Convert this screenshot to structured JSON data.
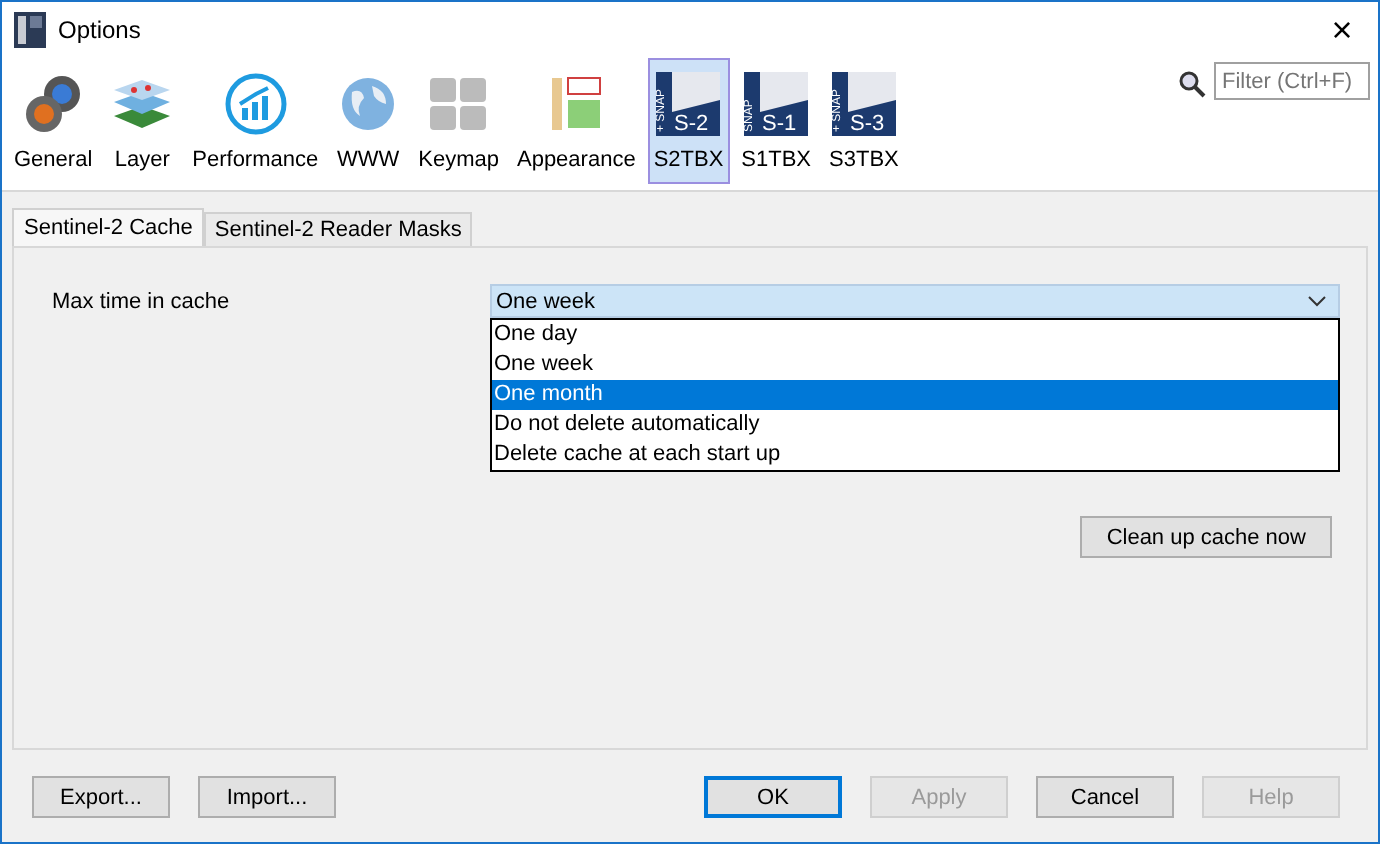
{
  "window": {
    "title": "Options",
    "close": "×"
  },
  "toolbar": {
    "items": [
      {
        "kind": "gears",
        "label": "General",
        "selected": false
      },
      {
        "kind": "layers",
        "label": "Layer",
        "selected": false
      },
      {
        "kind": "performance",
        "label": "Performance",
        "selected": false
      },
      {
        "kind": "globe",
        "label": "WWW",
        "selected": false
      },
      {
        "kind": "keys",
        "label": "Keymap",
        "selected": false
      },
      {
        "kind": "appearance",
        "label": "Appearance",
        "selected": false
      },
      {
        "kind": "snap",
        "label": "S2TBX",
        "selected": true,
        "badge": "S-2",
        "badge_top": "+ SNAP"
      },
      {
        "kind": "snap",
        "label": "S1TBX",
        "selected": false,
        "badge": "S-1",
        "badge_top": "SNAP"
      },
      {
        "kind": "snap",
        "label": "S3TBX",
        "selected": false,
        "badge": "S-3",
        "badge_top": "+ SNAP"
      }
    ],
    "filter": {
      "placeholder": "Filter (Ctrl+F)"
    }
  },
  "tabs": [
    {
      "label": "Sentinel-2 Cache",
      "selected": true
    },
    {
      "label": "Sentinel-2 Reader Masks",
      "selected": false
    }
  ],
  "cache": {
    "label": "Max time in cache",
    "value": "One week",
    "expanded": true,
    "options": [
      {
        "label": "One day",
        "highlighted": false
      },
      {
        "label": "One week",
        "highlighted": false
      },
      {
        "label": "One month",
        "highlighted": true
      },
      {
        "label": "Do not delete automatically",
        "highlighted": false
      },
      {
        "label": "Delete cache at each start up",
        "highlighted": false
      }
    ],
    "cleanup_button": "Clean up cache now"
  },
  "footer": {
    "left": [
      {
        "label": "Export...",
        "disabled": false
      },
      {
        "label": "Import...",
        "disabled": false
      }
    ],
    "right": [
      {
        "label": "OK",
        "disabled": false,
        "default": true
      },
      {
        "label": "Apply",
        "disabled": true,
        "default": false
      },
      {
        "label": "Cancel",
        "disabled": false,
        "default": false
      },
      {
        "label": "Help",
        "disabled": true,
        "default": false
      }
    ]
  }
}
